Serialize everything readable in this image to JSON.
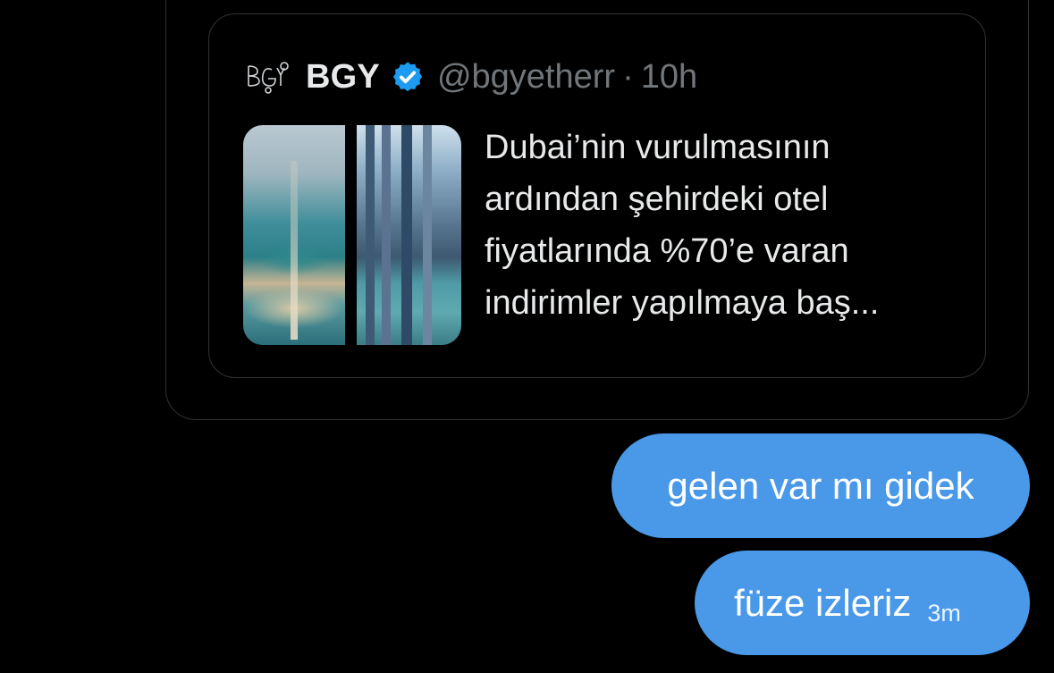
{
  "quote": {
    "display_name": "BGY",
    "handle": "@bgyetherr",
    "separator": "·",
    "time": "10h",
    "text_lines": [
      "Dubai’nin vurulmasının",
      "ardından şehirdeki otel",
      "fiyatlarında %70’e varan",
      "indirimler yapılmaya baş..."
    ],
    "verified_icon": "verified-badge-icon",
    "colors": {
      "verified": "#1d9bf0",
      "secondary_text": "#71767b"
    }
  },
  "messages": [
    {
      "text": "gelen var mı gidek"
    },
    {
      "text": "füze izleriz",
      "timestamp": "3m"
    }
  ],
  "colors": {
    "background": "#000000",
    "bubble": "#4a99e9",
    "card_border": "#2f3336"
  }
}
